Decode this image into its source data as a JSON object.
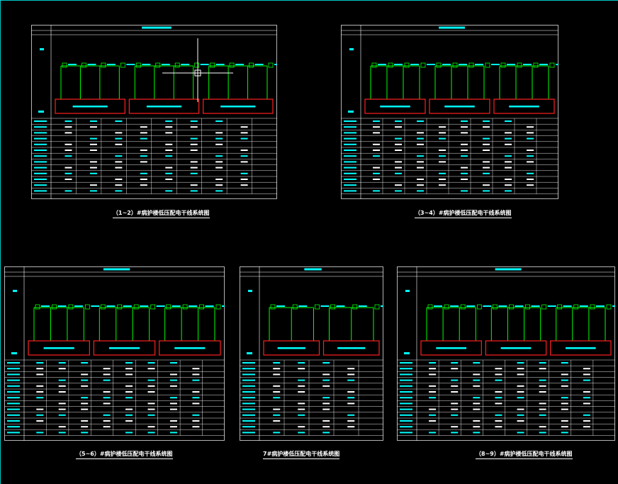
{
  "drawing": {
    "background": "#000000",
    "frame_color": "#ffffff",
    "busbar_color": "#00ff00",
    "panel_border_color": "#ff2020",
    "label_color": "#00ffff",
    "text_color": "#ffffff"
  },
  "sheets": [
    {
      "id": "sheet-1-2",
      "caption": "（1~2）#病护楼低压配电干线系统图",
      "panels": 3
    },
    {
      "id": "sheet-3-4",
      "caption": "（3~4）#病护楼低压配电干线系统图",
      "panels": 3
    },
    {
      "id": "sheet-5-6",
      "caption": "（5~6）#病护楼低压配电干线系统图",
      "panels": 3
    },
    {
      "id": "sheet-7",
      "caption": "7#病护楼低压配电干线系统图",
      "panels": 2
    },
    {
      "id": "sheet-8-9",
      "caption": "（8~9）#病护楼低压配电干线系统图",
      "panels": 3
    }
  ]
}
